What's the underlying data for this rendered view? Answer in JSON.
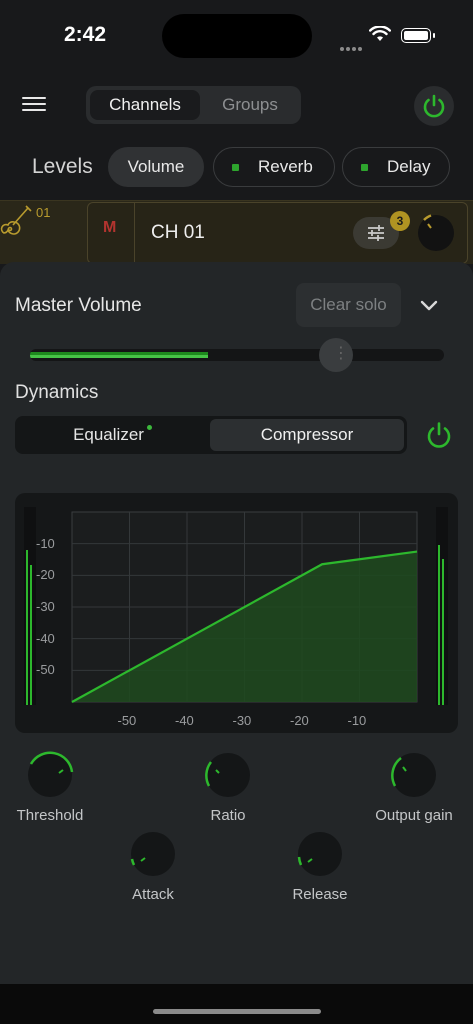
{
  "status": {
    "time": "2:42"
  },
  "nav": {
    "tab_channels": "Channels",
    "tab_groups": "Groups"
  },
  "levels": {
    "label": "Levels",
    "pills": {
      "volume": "Volume",
      "reverb": "Reverb",
      "delay": "Delay"
    }
  },
  "channel": {
    "number": "01",
    "mute": "M",
    "name": "CH 01",
    "badge_count": "3"
  },
  "master": {
    "title": "Master Volume",
    "clear_solo": "Clear solo",
    "level_fraction": 0.43
  },
  "dynamics": {
    "title": "Dynamics",
    "tab_equalizer": "Equalizer",
    "tab_compressor": "Compressor"
  },
  "chart_data": {
    "type": "area",
    "title": "",
    "xlabel": "",
    "ylabel": "",
    "xlim": [
      -60,
      0
    ],
    "ylim": [
      -60,
      0
    ],
    "x_ticks": [
      "-50",
      "-40",
      "-30",
      "-20",
      "-10"
    ],
    "y_ticks": [
      "-10",
      "-20",
      "-30",
      "-40",
      "-50"
    ],
    "series": [
      {
        "x": [
          -60,
          -16.5,
          0
        ],
        "y": [
          -60,
          -16.5,
          -12.5
        ]
      }
    ],
    "grid": true
  },
  "knobs": {
    "threshold": "Threshold",
    "ratio": "Ratio",
    "output_gain": "Output gain",
    "attack": "Attack",
    "release": "Release"
  },
  "colors": {
    "accent_green": "#2db82d",
    "channel_gold": "#b89b2e",
    "mute_red": "#b3342f"
  }
}
